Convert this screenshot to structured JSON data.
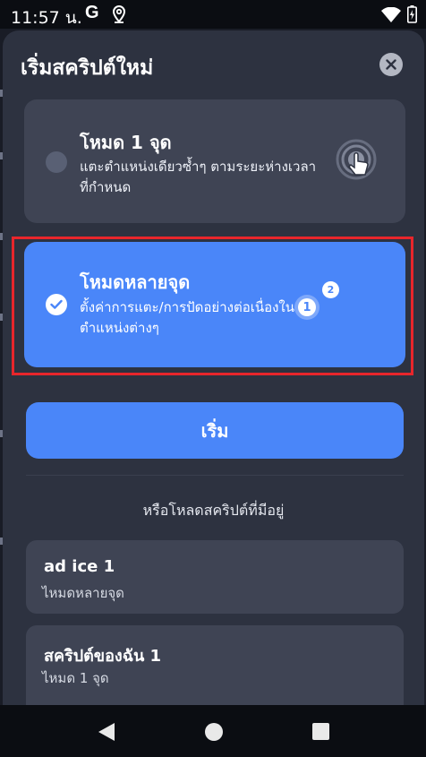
{
  "status_bar": {
    "time": "11:57 น.",
    "g_label": "G",
    "icons": [
      "google-icon",
      "location-icon",
      "wifi-icon",
      "battery-icon"
    ]
  },
  "sheet": {
    "title": "เริ่มสคริปต์ใหม่",
    "close_icon": "close-icon"
  },
  "modes": [
    {
      "title": "โหมด 1 จุด",
      "description": "แตะตำแหน่งเดียวซ้ำๆ ตามระยะห่างเวลาที่กำหนด",
      "selected": false,
      "icon": "single-tap-icon"
    },
    {
      "title": "โหมดหลายจุด",
      "description": "ตั้งค่าการแตะ/การปัดอย่างต่อเนื่องในตำแหน่งต่างๆ",
      "selected": true,
      "icon": "multi-point-icon",
      "badge_1": "1",
      "badge_2": "2"
    }
  ],
  "start_button": {
    "label": "เริ่ม"
  },
  "load_section": {
    "label": "หรือโหลดสคริปต์ที่มีอยู่",
    "saved": [
      {
        "name": "ad ice 1",
        "mode": "ไหมดหลายจุด"
      },
      {
        "name": "สคริปต์ของฉัน 1",
        "mode": "ไหมด 1 จุด"
      }
    ]
  },
  "nav_bar": {
    "icons": [
      "back-icon",
      "home-icon",
      "recents-icon"
    ]
  },
  "colors": {
    "accent": "#4a86f9",
    "sheet_bg": "#2d3240",
    "card_bg": "#3f4454",
    "highlight": "#e8262b"
  }
}
